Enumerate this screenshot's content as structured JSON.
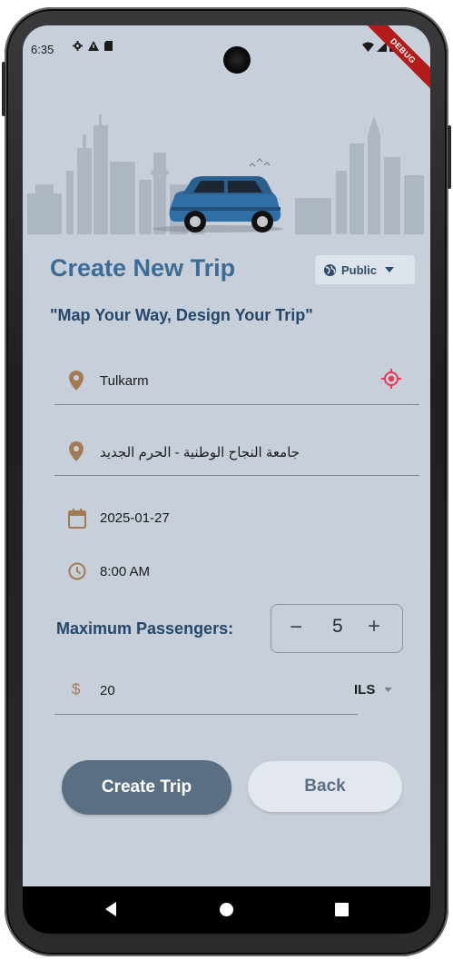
{
  "status_bar": {
    "time": "6:35",
    "left_icons": [
      "gear-icon",
      "warning-icon",
      "sd-card-icon"
    ],
    "right_icons": [
      "wifi-icon",
      "signal-icon",
      "battery-icon"
    ],
    "debug_banner": "DEBUG"
  },
  "header": {
    "title": "Create New Trip",
    "visibility": {
      "label": "Public",
      "icon": "globe-icon"
    },
    "tagline": "\"Map Your Way, Design Your Trip\""
  },
  "form": {
    "origin": {
      "value": "Tulkarm",
      "icon": "location-pin-icon",
      "action_icon": "my-location-icon"
    },
    "destination": {
      "value": "جامعة النجاح الوطنية - الحرم الجديد",
      "icon": "location-pin-icon"
    },
    "date": {
      "value": "2025-01-27",
      "icon": "calendar-icon"
    },
    "time": {
      "value": "8:00 AM",
      "icon": "clock-icon"
    },
    "passengers": {
      "label": "Maximum Passengers:",
      "minus": "−",
      "count": "5",
      "plus": "+"
    },
    "price": {
      "symbol": "$",
      "value": "20"
    },
    "currency": {
      "selected": "ILS"
    }
  },
  "actions": {
    "create": "Create Trip",
    "back": "Back"
  },
  "colors": {
    "screen_bg": "#c7cfdb",
    "title": "#3b6c96",
    "accent_label": "#24476a",
    "icon_brown": "#a27b55",
    "location_red": "#e53955",
    "primary_button": "#5a6f84",
    "secondary_button": "#e3e8ee",
    "car_blue": "#2f6fa6"
  }
}
